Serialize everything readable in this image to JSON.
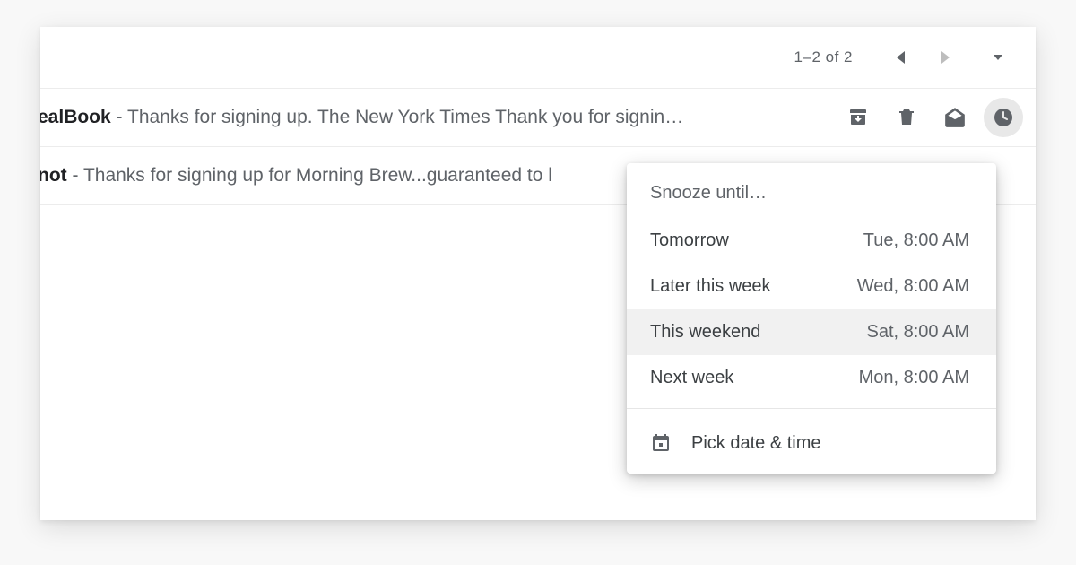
{
  "toolbar": {
    "count_label": "1–2 of 2"
  },
  "emails": [
    {
      "sender_fragment": "ealBook",
      "preview": " - Thanks for signing up. The New York Times Thank you for signin…"
    },
    {
      "sender_fragment": "not",
      "preview": " - Thanks for signing up for Morning Brew...guaranteed to l"
    }
  ],
  "snooze": {
    "title": "Snooze until…",
    "options": [
      {
        "label": "Tomorrow",
        "when": "Tue, 8:00 AM"
      },
      {
        "label": "Later this week",
        "when": "Wed, 8:00 AM"
      },
      {
        "label": "This weekend",
        "when": "Sat, 8:00 AM"
      },
      {
        "label": "Next week",
        "when": "Mon, 8:00 AM"
      }
    ],
    "highlighted_index": 2,
    "pick_label": "Pick date & time"
  }
}
